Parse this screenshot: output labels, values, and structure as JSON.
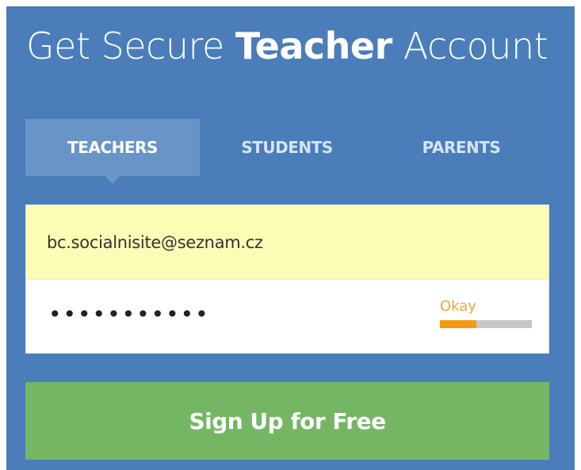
{
  "header": {
    "title_prefix": "Get Secure ",
    "title_bold": "Teacher",
    "title_suffix": " Account"
  },
  "tabs": [
    {
      "label": "TEACHERS",
      "active": true
    },
    {
      "label": "STUDENTS",
      "active": false
    },
    {
      "label": "PARENTS",
      "active": false
    }
  ],
  "form": {
    "email_value": "bc.socialnisite@seznam.cz",
    "password_masked": "•••••••••••",
    "strength_label": "Okay",
    "strength_level": 0.4
  },
  "signup_button_label": "Sign Up for Free",
  "colors": {
    "panel_bg": "#4a7dba",
    "active_tab_bg": "#6894c7",
    "email_bg": "#fbfdb6",
    "strength_color": "#f39c12",
    "button_bg": "#75b665"
  }
}
